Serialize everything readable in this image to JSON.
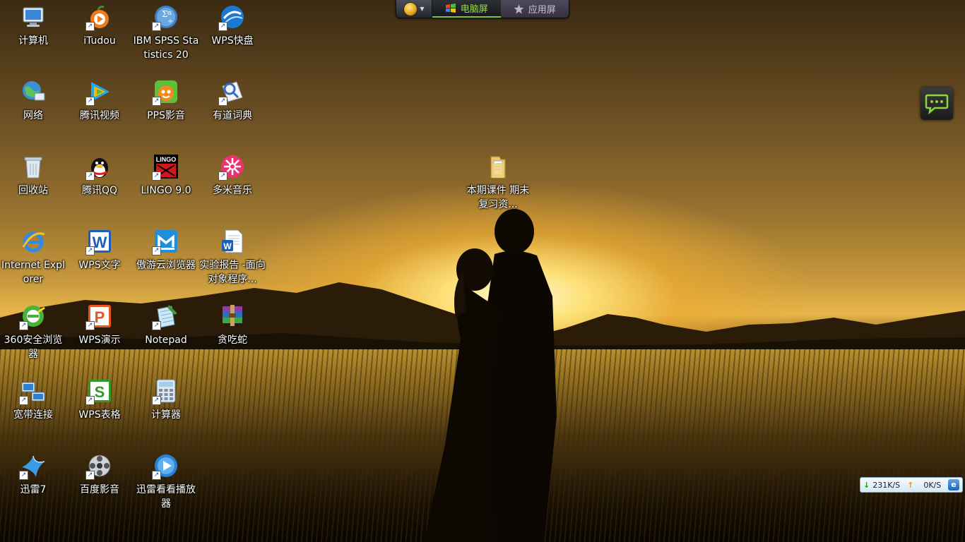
{
  "switcher": {
    "tabs": [
      {
        "label": "电脑屏",
        "icon": "windows-flag-icon",
        "active": true
      },
      {
        "label": "应用屏",
        "icon": "star-icon",
        "active": false
      }
    ]
  },
  "desktop": {
    "icons": [
      {
        "label": "计算机",
        "icon": "computer-icon"
      },
      {
        "label": "iTudou",
        "icon": "itudou-icon"
      },
      {
        "label": "IBM SPSS Statistics 20",
        "icon": "spss-icon"
      },
      {
        "label": "WPS快盘",
        "icon": "wps-cloud-icon"
      },
      {
        "label": "网络",
        "icon": "network-icon"
      },
      {
        "label": "腾讯视频",
        "icon": "tencent-video-icon"
      },
      {
        "label": "PPS影音",
        "icon": "pps-icon"
      },
      {
        "label": "有道词典",
        "icon": "youdao-dict-icon"
      },
      {
        "label": "回收站",
        "icon": "recycle-bin-icon"
      },
      {
        "label": "腾讯QQ",
        "icon": "qq-penguin-icon"
      },
      {
        "label": "LINGO 9.0",
        "icon": "lingo-icon"
      },
      {
        "label": "多米音乐",
        "icon": "duomi-music-icon"
      },
      {
        "label": "Internet Explorer",
        "icon": "internet-explorer-icon"
      },
      {
        "label": "WPS文字",
        "icon": "wps-writer-icon"
      },
      {
        "label": "傲游云浏览器",
        "icon": "maxthon-browser-icon"
      },
      {
        "label": "实验报告 -面向对象程序...",
        "icon": "word-document-icon"
      },
      {
        "label": "360安全浏览器",
        "icon": "360-browser-icon"
      },
      {
        "label": "WPS演示",
        "icon": "wps-presentation-icon"
      },
      {
        "label": "Notepad",
        "icon": "notepad-icon"
      },
      {
        "label": "贪吃蛇",
        "icon": "winrar-archive-icon"
      },
      {
        "label": "宽带连接",
        "icon": "broadband-connection-icon"
      },
      {
        "label": "WPS表格",
        "icon": "wps-spreadsheet-icon"
      },
      {
        "label": "计算器",
        "icon": "calculator-icon"
      },
      {
        "label": "迅雷7",
        "icon": "thunder-bird-icon"
      },
      {
        "label": "百度影音",
        "icon": "baidu-player-icon"
      },
      {
        "label": "迅雷看看播放器",
        "icon": "xunlei-kankan-icon"
      },
      {
        "label": "本期课件 期末复习资...",
        "icon": "folder-icon"
      }
    ]
  },
  "widgets": {
    "chat_icon": "chat-bubble-icon",
    "net_speed": {
      "download": "231K/S",
      "upload": "0K/S",
      "download_icon": "arrow-down-icon",
      "upload_icon": "arrow-up-icon",
      "browser_icon": "ie-icon"
    }
  },
  "colors": {
    "switcher_active_text": "#9dd85a",
    "switcher_inactive_text": "#c9c6d2",
    "label_text": "#ffffff"
  }
}
